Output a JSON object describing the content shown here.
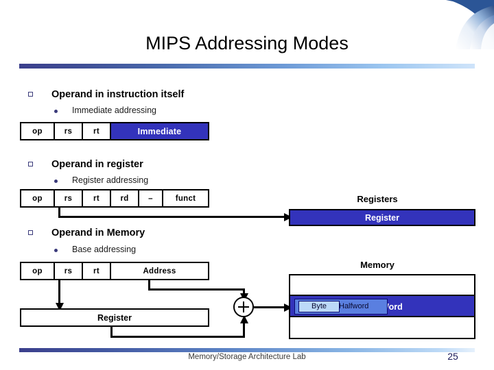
{
  "slide": {
    "title": "MIPS Addressing Modes",
    "footer": "Memory/Storage Architecture Lab",
    "page_number": "25",
    "accent_color": "#3333bb",
    "rule_color_start": "#3b3f8c",
    "rule_color_end": "#cfe4fa"
  },
  "sections": [
    {
      "heading": "Operand in instruction itself",
      "subbullet": "Immediate addressing",
      "fields": [
        {
          "label": "op",
          "style": "plain"
        },
        {
          "label": "rs",
          "style": "plain"
        },
        {
          "label": "rt",
          "style": "plain"
        },
        {
          "label": "Immediate",
          "style": "highlight"
        }
      ]
    },
    {
      "heading": "Operand in register",
      "subbullet": "Register addressing",
      "fields": [
        {
          "label": "op",
          "style": "plain"
        },
        {
          "label": "rs",
          "style": "plain"
        },
        {
          "label": "rt",
          "style": "plain"
        },
        {
          "label": "rd",
          "style": "plain"
        },
        {
          "label": "–",
          "style": "plain"
        },
        {
          "label": "funct",
          "style": "plain"
        }
      ]
    },
    {
      "heading": "Operand in Memory",
      "subbullet": "Base addressing",
      "fields": [
        {
          "label": "op",
          "style": "plain"
        },
        {
          "label": "rs",
          "style": "plain"
        },
        {
          "label": "rt",
          "style": "plain"
        },
        {
          "label": "Address",
          "style": "plain"
        }
      ]
    }
  ],
  "registers_unit": {
    "caption": "Registers",
    "selected_entry": "Register"
  },
  "base_register": {
    "label": "Register"
  },
  "adder": {
    "symbol": "+"
  },
  "memory_unit": {
    "caption": "Memory",
    "word_label": "Word",
    "halfword_label": "Halfword",
    "byte_label": "Byte"
  }
}
